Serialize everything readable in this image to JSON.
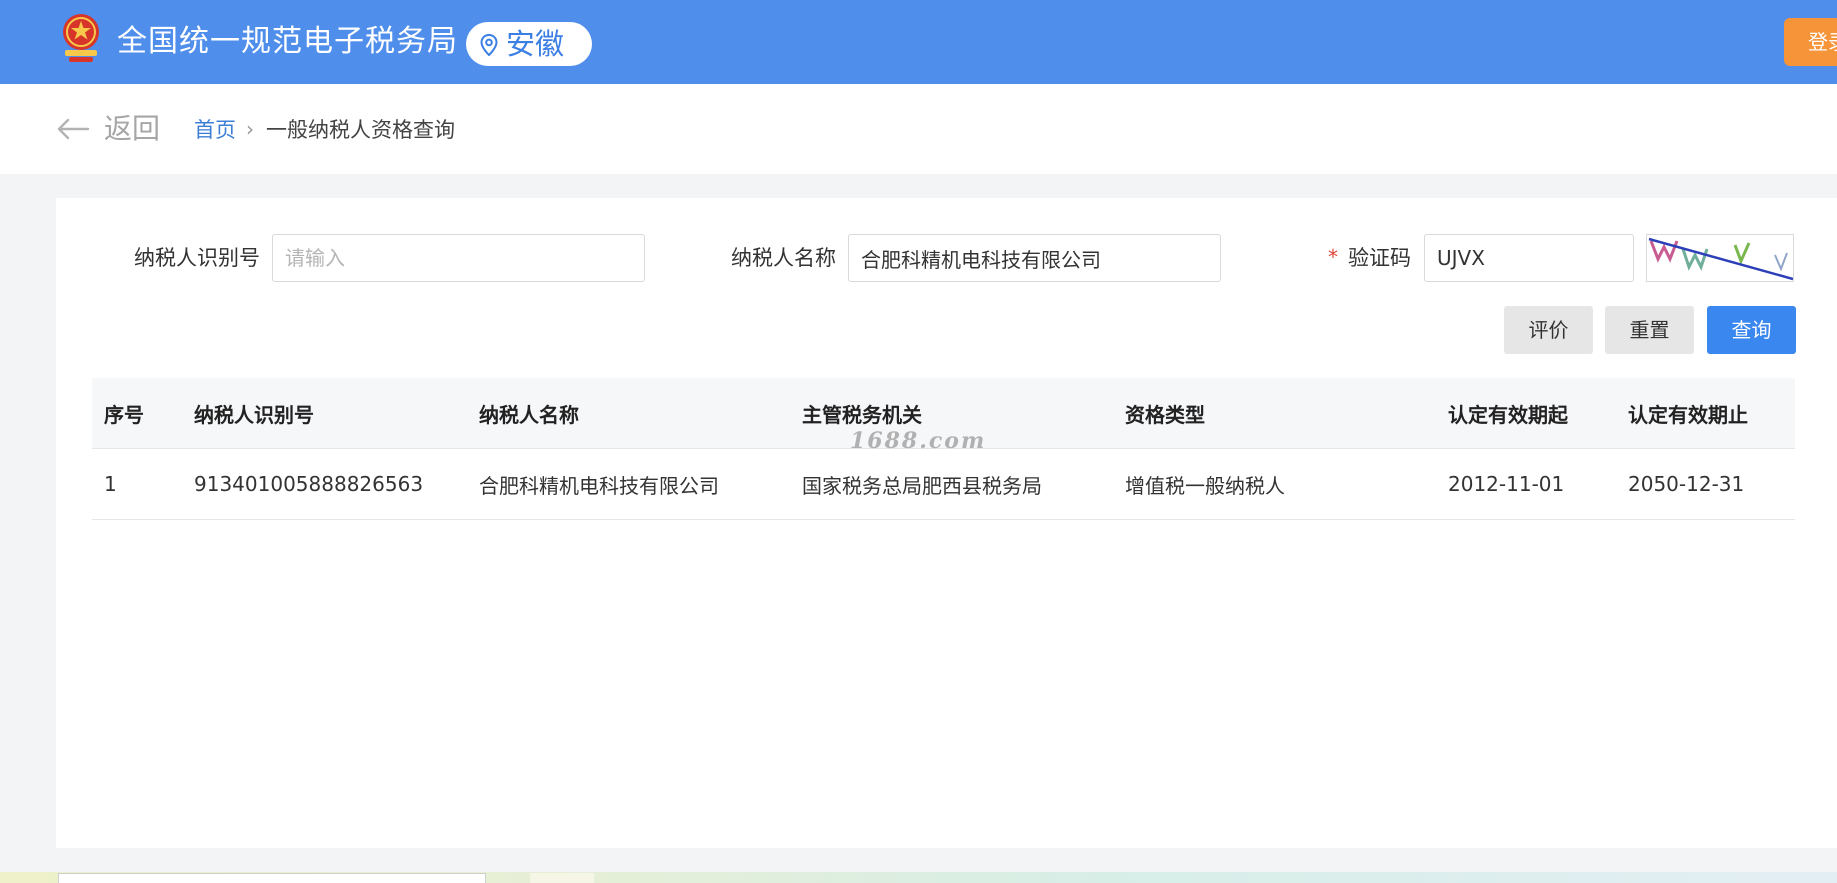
{
  "header": {
    "site_title": "全国统一规范电子税务局",
    "region": "安徽",
    "login_label": "登录",
    "emblem_icon": "tax-emblem-icon",
    "region_icon": "location-pin-icon",
    "background_color": "#4f8eeb",
    "login_color": "#f6943a"
  },
  "breadcrumb": {
    "back_label": "返回",
    "back_icon": "arrow-left-icon",
    "home_label": "首页",
    "separator": "›",
    "current_label": "一般纳税人资格查询"
  },
  "form": {
    "taxpayer_id": {
      "label": "纳税人识别号",
      "value": "",
      "placeholder": "请输入"
    },
    "taxpayer_name": {
      "label": "纳税人名称",
      "value": "合肥科精机电科技有限公司",
      "placeholder": ""
    },
    "captcha": {
      "required_mark": "*",
      "label": "验证码",
      "value": "UJVX",
      "image_icon": "captcha-image-icon"
    }
  },
  "buttons": {
    "evaluate_label": "评价",
    "reset_label": "重置",
    "query_label": "查询",
    "primary_color": "#3b87f0"
  },
  "table": {
    "headers": [
      "序号",
      "纳税人识别号",
      "纳税人名称",
      "主管税务机关",
      "资格类型",
      "认定有效期起",
      "认定有效期止"
    ],
    "rows": [
      [
        "1",
        "913401005888826563",
        "合肥科精机电科技有限公司",
        "国家税务总局肥西县税务局",
        "增值税一般纳税人",
        "2012-11-01",
        "2050-12-31"
      ]
    ]
  },
  "watermark": "1688.com"
}
